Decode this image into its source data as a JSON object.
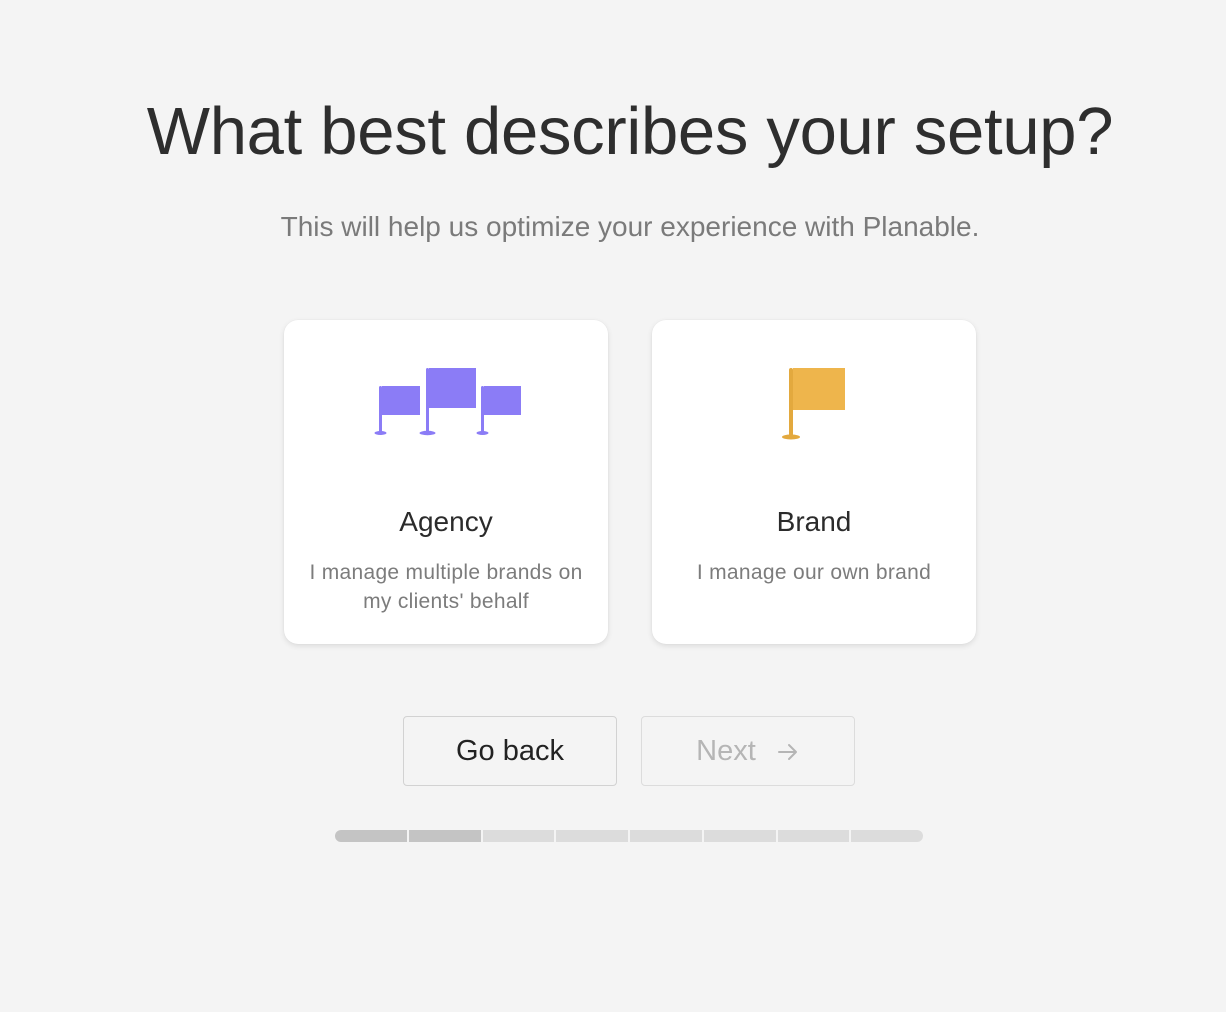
{
  "header": {
    "title": "What best describes your setup?",
    "subtitle": "This will help us optimize your experience with Planable."
  },
  "options": [
    {
      "title": "Agency",
      "description": "I manage multiple brands on my clients' behalf",
      "icon": "three-flags-icon",
      "icon_color": "#8b7cf6"
    },
    {
      "title": "Brand",
      "description": "I manage our own brand",
      "icon": "single-flag-icon",
      "icon_color": "#eeb54c"
    }
  ],
  "buttons": {
    "back_label": "Go back",
    "next_label": "Next",
    "next_icon": "arrow-right-icon"
  },
  "progress": {
    "total_steps": 8,
    "completed_steps": 2
  }
}
